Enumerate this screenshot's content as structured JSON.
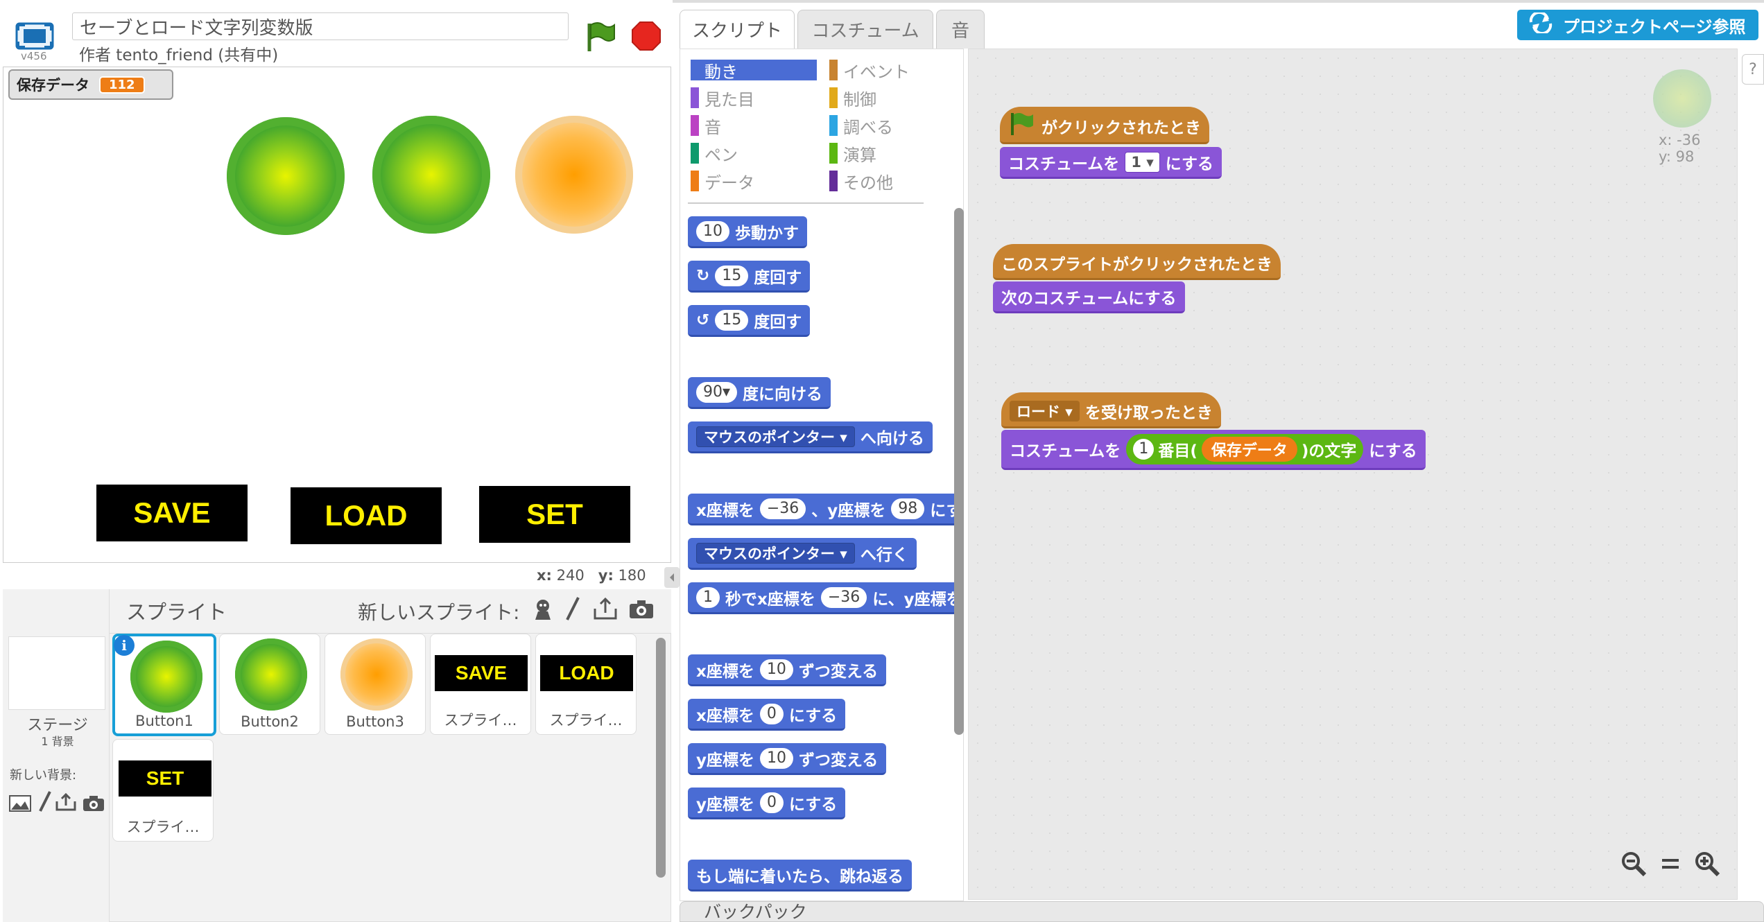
{
  "header": {
    "version": "v456",
    "project_title": "セーブとロード文字列変数版",
    "author": "作者 tento_friend (共有中)"
  },
  "stage": {
    "variable_monitor": {
      "name": "保存データ",
      "value": "112"
    },
    "buttons": [
      "SAVE",
      "LOAD",
      "SET"
    ],
    "coords": {
      "x_label": "x:",
      "x_value": "240",
      "y_label": "y:",
      "y_value": "180"
    }
  },
  "sprites_pane": {
    "title": "スプライト",
    "new_sprite_label": "新しいスプライト:",
    "stage_label": "ステージ",
    "stage_backdrops": "1 背景",
    "new_backdrop_label": "新しい背景:",
    "sprites": [
      {
        "name": "Button1",
        "kind": "green"
      },
      {
        "name": "Button2",
        "kind": "green"
      },
      {
        "name": "Button3",
        "kind": "orange"
      },
      {
        "name": "スプライ…",
        "kind": "text",
        "text": "SAVE"
      },
      {
        "name": "スプライ…",
        "kind": "text",
        "text": "LOAD"
      },
      {
        "name": "スプライ…",
        "kind": "text",
        "text": "SET"
      }
    ]
  },
  "tabs": [
    "スクリプト",
    "コスチューム",
    "音"
  ],
  "categories": {
    "left": [
      {
        "label": "動き",
        "color": "#4a6cd4",
        "active": true
      },
      {
        "label": "見た目",
        "color": "#8a55d7"
      },
      {
        "label": "音",
        "color": "#bb42c3"
      },
      {
        "label": "ペン",
        "color": "#0e9a6c"
      },
      {
        "label": "データ",
        "color": "#ee7d16"
      }
    ],
    "right": [
      {
        "label": "イベント",
        "color": "#c88330"
      },
      {
        "label": "制御",
        "color": "#e1a91a"
      },
      {
        "label": "調べる",
        "color": "#2ca5e2"
      },
      {
        "label": "演算",
        "color": "#5cb712"
      },
      {
        "label": "その他",
        "color": "#632d99"
      }
    ]
  },
  "palette_blocks": {
    "move": {
      "value": "10",
      "text": "歩動かす"
    },
    "turn_right": {
      "value": "15",
      "text": "度回す"
    },
    "turn_left": {
      "value": "15",
      "text": "度回す"
    },
    "point_dir": {
      "value": "90▾",
      "text": "度に向ける"
    },
    "point_towards": {
      "dropdown": "マウスのポインター ▾",
      "text": "へ向ける"
    },
    "goto_xy": {
      "a": "x座標を",
      "x": "−36",
      "b": "、y座標を",
      "y": "98",
      "c": "にする"
    },
    "goto": {
      "dropdown": "マウスのポインター ▾",
      "text": "へ行く"
    },
    "glide": {
      "secs": "1",
      "a": "秒でx座標を",
      "x": "−36",
      "b": "に、y座標を"
    },
    "change_x": {
      "a": "x座標を",
      "v": "10",
      "b": "ずつ変える"
    },
    "set_x": {
      "a": "x座標を",
      "v": "0",
      "b": "にする"
    },
    "change_y": {
      "a": "y座標を",
      "v": "10",
      "b": "ずつ変える"
    },
    "set_y": {
      "a": "y座標を",
      "v": "0",
      "b": "にする"
    },
    "bounce": {
      "text": "もし端に着いたら、跳ね返る"
    }
  },
  "scripts": {
    "s1_hat": "がクリックされたとき",
    "s1_a": "コスチュームを",
    "s1_dd": "1 ▾",
    "s1_b": "にする",
    "s2_hat": "このスプライトがクリックされたとき",
    "s2_cmd": "次のコスチュームにする",
    "s3_dd": "ロード ▾",
    "s3_hat": "を受け取ったとき",
    "s3_a": "コスチュームを",
    "s3_num": "1",
    "s3_b": "番目(",
    "s3_var": "保存データ",
    "s3_c": ")の文字",
    "s3_d": "にする"
  },
  "project_page_button": "プロジェクトページ参照",
  "help": "?",
  "sprite_info": {
    "x": "x: -36",
    "y": "y: 98"
  },
  "backpack": "バックパック",
  "colors": {
    "accent": "#1c9ad6",
    "motion": "#4a6cd4",
    "looks": "#8a55d7",
    "events": "#c88330",
    "operators": "#5cb712",
    "data": "#ee7d16"
  }
}
